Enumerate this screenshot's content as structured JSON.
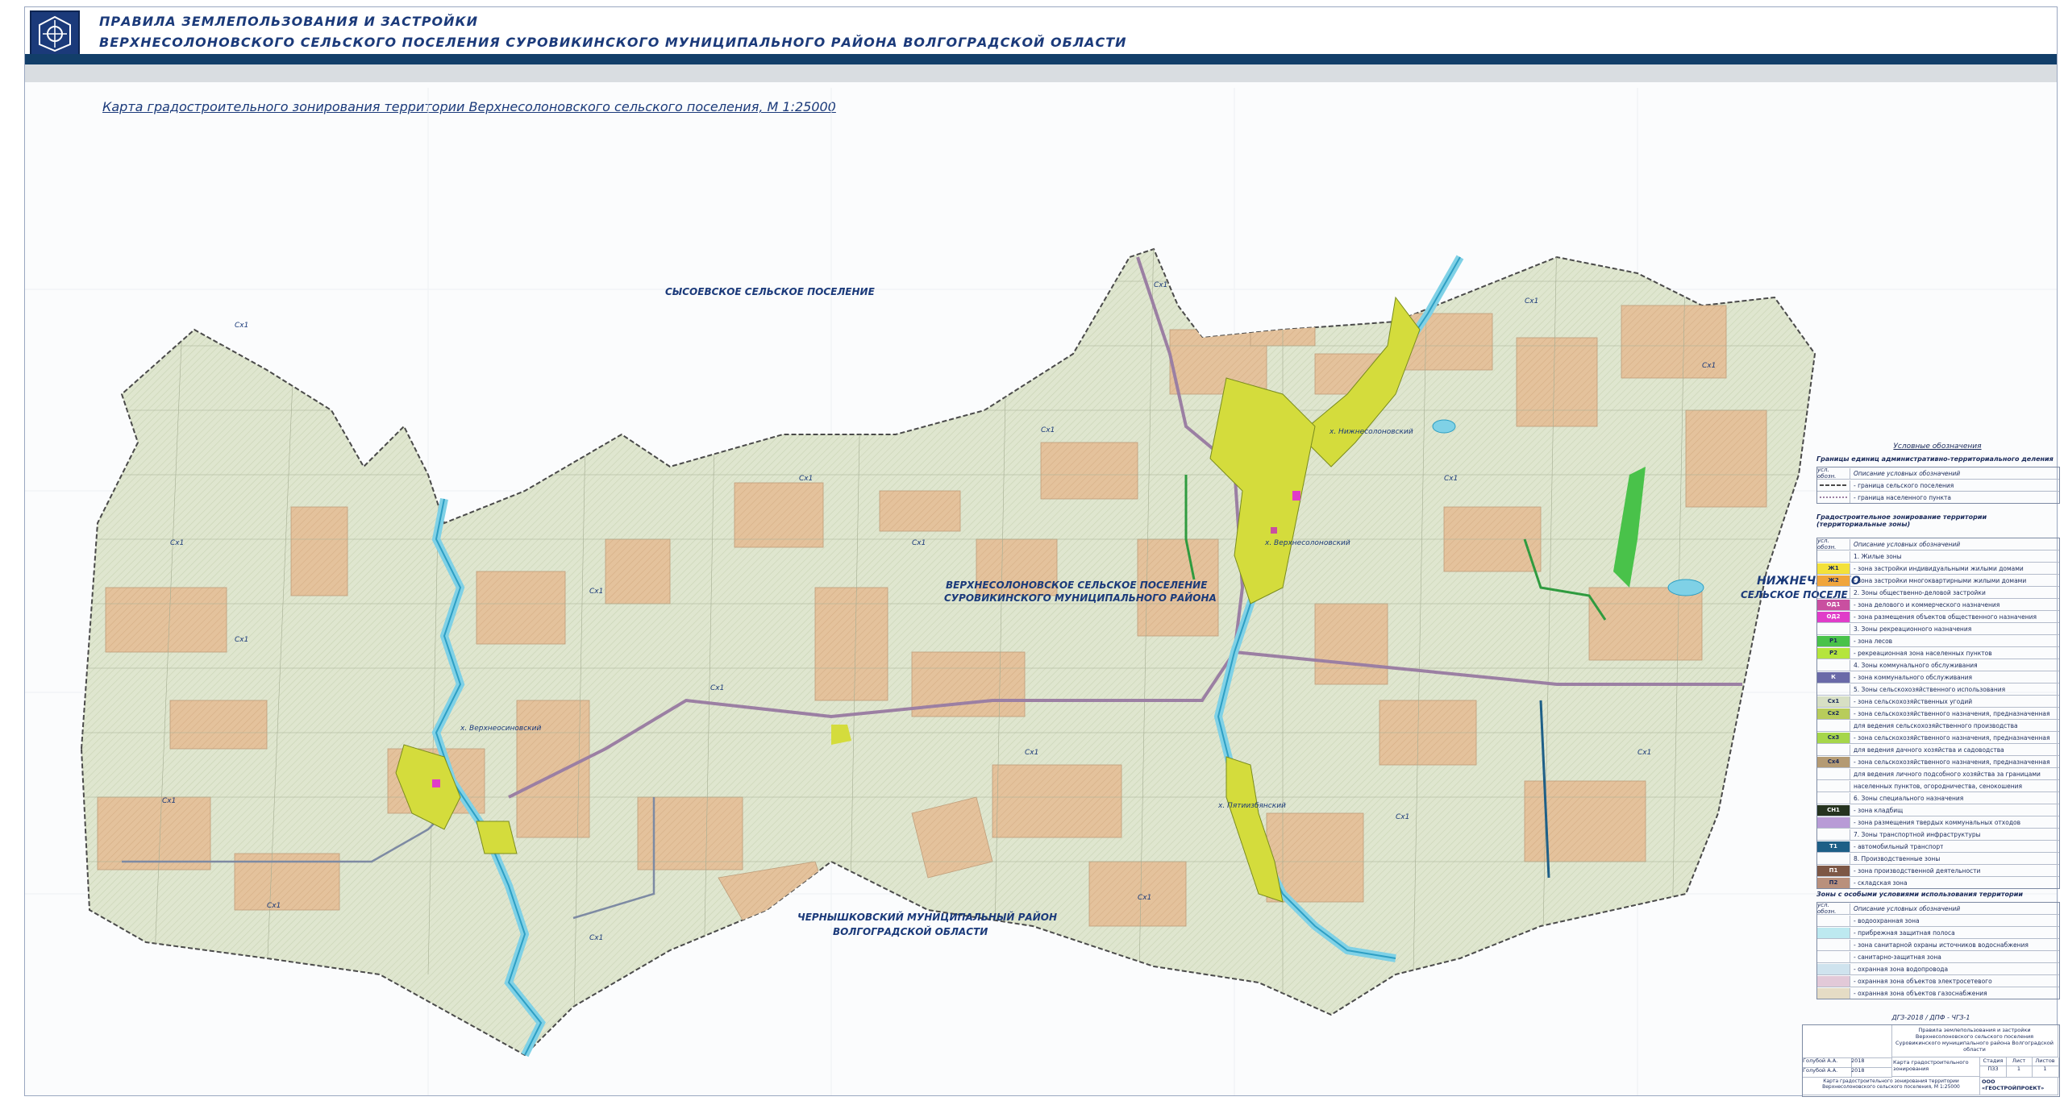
{
  "header": {
    "line1": "ПРАВИЛА ЗЕМЛЕПОЛЬЗОВАНИЯ И ЗАСТРОЙКИ",
    "line2": "ВЕРХНЕСОЛОНОВСКОГО СЕЛЬСКОГО ПОСЕЛЕНИЯ СУРОВИКИНСКОГО МУНИЦИПАЛЬНОГО РАЙОНА ВОЛГОГРАДСКОЙ ОБЛАСТИ"
  },
  "map": {
    "title": "Карта градостроительного зонирования территории Верхнесолоновского сельского поселения, М 1:25000",
    "labels": {
      "north": "СЫСОЕВСКОЕ СЕЛЬСКОЕ ПОСЕЛЕНИЕ",
      "center_1": "ВЕРХНЕСОЛОНОВСКОЕ СЕЛЬСКОЕ ПОСЕЛЕНИЕ",
      "center_2": "СУРОВИКИНСКОГО МУНИЦИПАЛЬНОГО РАЙОНА",
      "south_1": "ЧЕРНЫШКОВСКИЙ МУНИЦИПАЛЬНЫЙ РАЙОН",
      "south_2": "ВОЛГОГРАДСКОЙ ОБЛАСТИ",
      "east_1": "НИЖНЕЧИРСКО",
      "east_2": "СЕЛЬСКОЕ ПОСЕЛЕ"
    },
    "settlements": {
      "nizhnesolonovsky": "х. Нижнесолоновский",
      "verkhnesolonovsky": "х. Верхнесолоновский",
      "verkhneosinovsky": "х. Верхнеосиновский",
      "pyatiizbyanka": "х. Пятиизбянский"
    },
    "zone_tag": "Сх1"
  },
  "colors": {
    "farmland": "#dfe6cf",
    "arable_brown": "#e4c29c",
    "river": "#7fd1e6",
    "border_pink": "#b86a86",
    "road": "#9b7fa3",
    "settlement_yellow": "#d4dc3c",
    "header_blue": "#123e69"
  },
  "legend": {
    "title": "Условные обозначения",
    "section1": {
      "title": "Границы единиц административно-территориального деления",
      "head": [
        "усл. обозн.",
        "Описание условных обозначений"
      ],
      "rows": [
        {
          "sw": "",
          "text": "- граница сельского поселения"
        },
        {
          "sw": "",
          "text": "- граница населенного пункта"
        }
      ]
    },
    "section2": {
      "title": "Градостроительное зонирование территории (территориальные зоны)",
      "head": [
        "усл. обозн.",
        "Описание условных обозначений"
      ],
      "rows": [
        {
          "sw": "",
          "text": "1. Жилые зоны",
          "color": "#ffffff"
        },
        {
          "sw": "Ж1",
          "text": "- зона застройки индивидуальными жилыми домами",
          "color": "#f3e13a"
        },
        {
          "sw": "Ж2",
          "text": "- зона застройки многоквартирными жилыми домами",
          "color": "#f0a53c"
        },
        {
          "sw": "",
          "text": "2. Зоны общественно-деловой застройки",
          "color": "#ffffff"
        },
        {
          "sw": "ОД1",
          "text": "- зона делового и коммерческого назначения",
          "color": "#c94fa0"
        },
        {
          "sw": "ОД2",
          "text": "- зона размещения объектов общественного назначения",
          "color": "#e03cc9"
        },
        {
          "sw": "",
          "text": "3. Зоны рекреационного назначения",
          "color": "#ffffff"
        },
        {
          "sw": "Р1",
          "text": "- зона лесов",
          "color": "#49c24a"
        },
        {
          "sw": "Р2",
          "text": "- рекреационная зона населенных пунктов",
          "color": "#b5e53c"
        },
        {
          "sw": "",
          "text": "4. Зоны коммунального обслуживания",
          "color": "#ffffff"
        },
        {
          "sw": "К",
          "text": "- зона коммунального обслуживания",
          "color": "#6a6aa8"
        },
        {
          "sw": "",
          "text": "5. Зоны сельскохозяйственного использования",
          "color": "#ffffff"
        },
        {
          "sw": "Сх1",
          "text": "- зона сельскохозяйственных угодий",
          "color": "#d7dfc4"
        },
        {
          "sw": "Сх2",
          "text": "- зона сельскохозяйственного назначения, предназначенная",
          "color": "#b8cc5b"
        },
        {
          "sw": "",
          "text": "для ведения сельскохозяйственного производства",
          "color": "#ffffff"
        },
        {
          "sw": "Сх3",
          "text": "- зона сельскохозяйственного назначения, предназначенная",
          "color": "#a6d64a"
        },
        {
          "sw": "",
          "text": "для ведения дачного хозяйства и садоводства",
          "color": "#ffffff"
        },
        {
          "sw": "Сх4",
          "text": "- зона сельскохозяйственного назначения, предназначенная",
          "color": "#b49a73"
        },
        {
          "sw": "",
          "text": "для ведения личного подсобного хозяйства за границами",
          "color": "#ffffff"
        },
        {
          "sw": "",
          "text": "населенных пунктов, огородничества, сенокошения",
          "color": "#ffffff"
        },
        {
          "sw": "",
          "text": "6. Зоны специального назначения",
          "color": "#ffffff"
        },
        {
          "sw": "СН1",
          "text": "- зона кладбищ",
          "color": "#25331f"
        },
        {
          "sw": "",
          "text": "- зона размещения твердых коммунальных отходов",
          "color": "#b89bd6"
        },
        {
          "sw": "",
          "text": "7. Зоны транспортной инфраструктуры",
          "color": "#ffffff"
        },
        {
          "sw": "Т1",
          "text": "- автомобильный транспорт",
          "color": "#1e5f87"
        },
        {
          "sw": "",
          "text": "8. Производственные зоны",
          "color": "#ffffff"
        },
        {
          "sw": "П1",
          "text": "- зона производственной деятельности",
          "color": "#7d5745"
        },
        {
          "sw": "П2",
          "text": "- складская зона",
          "color": "#b9907c"
        }
      ]
    },
    "section3": {
      "title": "Зоны с особыми условиями использования территории",
      "head": [
        "усл. обозн.",
        "Описание условных обозначений"
      ],
      "rows": [
        {
          "sw": "",
          "text": "- водоохранная зона",
          "color": "#ffffff"
        },
        {
          "sw": "",
          "text": "- прибрежная защитная полоса",
          "color": "#bde9f0"
        },
        {
          "sw": "",
          "text": "- зона санитарной охраны источников водоснабжения",
          "color": "#ffffff"
        },
        {
          "sw": "",
          "text": "- санитарно-защитная зона",
          "color": "#ffffff"
        },
        {
          "sw": "",
          "text": "- охранная зона водопровода",
          "color": "#cfe3ee"
        },
        {
          "sw": "",
          "text": "- охранная зона объектов электросетевого",
          "color": "#e2c9d8"
        },
        {
          "sw": "",
          "text": "- охранная зона объектов газоснабжения",
          "color": "#e5dcc5"
        }
      ]
    }
  },
  "stamp": {
    "code": "ДГЗ-2018 / ДПФ - ЧГЗ-1",
    "project": "Правила землепользования и застройки Верхнесолоновского сельского поселения Суровикинского муниципального района Волгоградской области",
    "sheet_name": "Карта градостроительного зонирования",
    "stage": "ПЗЗ",
    "sheet": "1",
    "sheets": "1",
    "stage_label": "Стадия",
    "sheet_label": "Лист",
    "sheets_label": "Листов",
    "author1": "Голубой А.А.",
    "author2": "Голубой А.А.",
    "year1": "2018",
    "year2": "2018",
    "org": "ООО «ГЕОСТРОЙПРОЕКТ»",
    "map_caption": "Карта градостроительного зонирования территории Верхнесолоновского сельского поселения, М 1:25000"
  }
}
